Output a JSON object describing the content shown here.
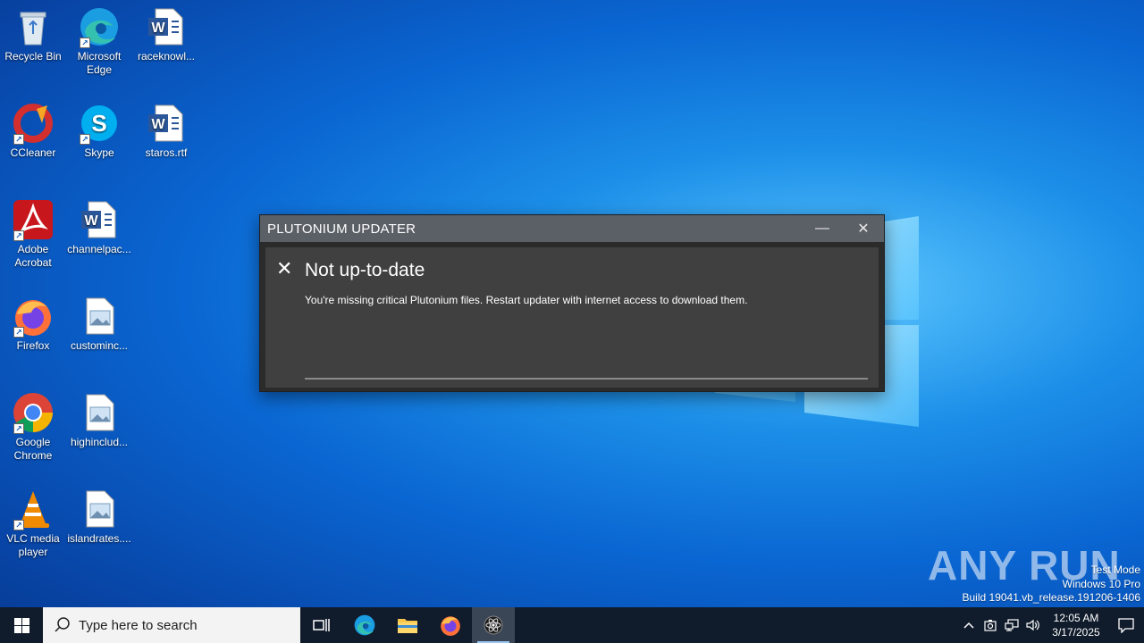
{
  "desktop": {
    "icons": [
      {
        "label": "Recycle Bin",
        "icon": "recycle-bin-icon"
      },
      {
        "label": "Microsoft Edge",
        "icon": "edge-icon"
      },
      {
        "label": "raceknowl...",
        "icon": "word-document-icon"
      },
      {
        "label": "CCleaner",
        "icon": "ccleaner-icon"
      },
      {
        "label": "Skype",
        "icon": "skype-icon"
      },
      {
        "label": "staros.rtf",
        "icon": "word-document-icon"
      },
      {
        "label": "Adobe Acrobat",
        "icon": "acrobat-icon"
      },
      {
        "label": "channelpac...",
        "icon": "word-document-icon"
      },
      {
        "label": "Firefox",
        "icon": "firefox-icon"
      },
      {
        "label": "custominc...",
        "icon": "image-file-icon"
      },
      {
        "label": "Google Chrome",
        "icon": "chrome-icon"
      },
      {
        "label": "highinclud...",
        "icon": "image-file-icon"
      },
      {
        "label": "VLC media player",
        "icon": "vlc-icon"
      },
      {
        "label": "islandrates....",
        "icon": "image-file-icon"
      }
    ]
  },
  "dialog": {
    "title": "PLUTONIUM UPDATER",
    "minimize_label": "—",
    "close_label": "✕",
    "status_icon": "close-icon",
    "heading": "Not up-to-date",
    "message": "You're missing critical Plutonium files. Restart updater with internet access to download them."
  },
  "watermark": {
    "brand": "ANY RUN",
    "line1": "Test Mode",
    "line2": "Windows 10 Pro",
    "line3": "Build 19041.vb_release.191206-1406"
  },
  "taskbar": {
    "search_placeholder": "Type here to search",
    "pinned": [
      "task-view-icon",
      "edge-icon",
      "file-explorer-icon",
      "firefox-icon",
      "plutonium-icon"
    ],
    "time": "12:05 AM",
    "date": "3/17/2025"
  },
  "colors": {
    "titlebar": "#5b5f66",
    "dialog_body": "#404040",
    "taskbar": "#101b2b"
  }
}
